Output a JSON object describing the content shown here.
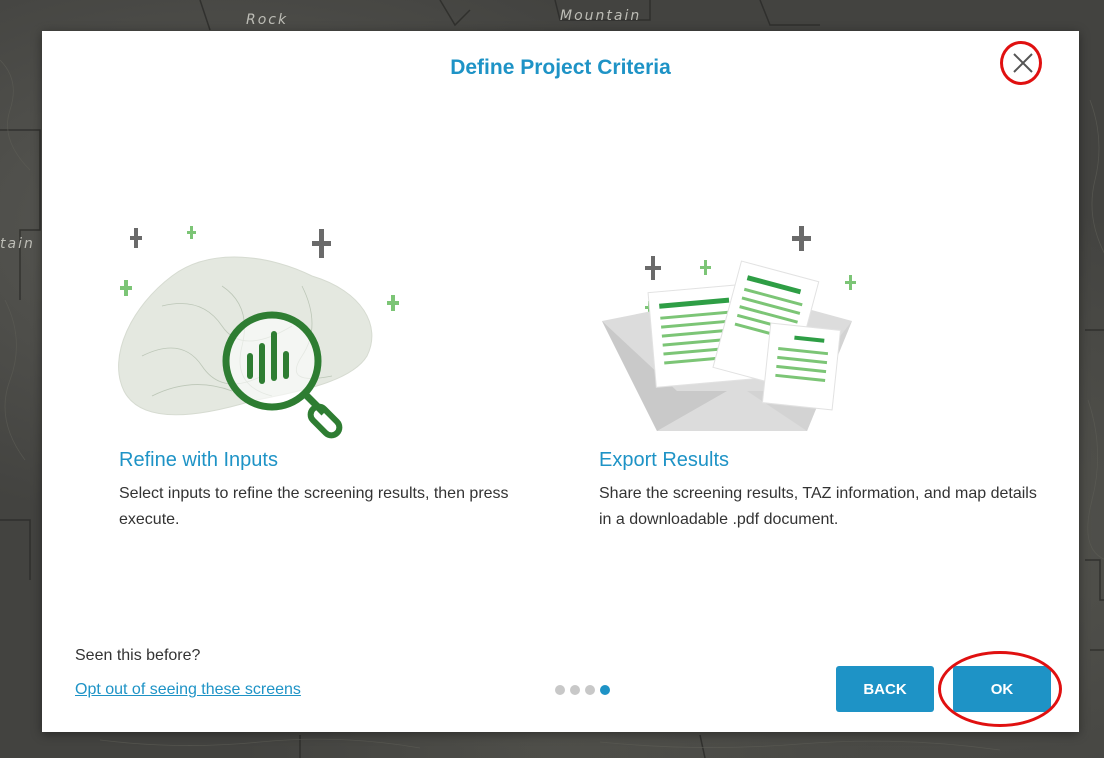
{
  "map": {
    "labels": [
      "Rock",
      "Mountain",
      "tain"
    ]
  },
  "modal": {
    "title": "Define Project Criteria",
    "close_icon": "close-icon",
    "cards": [
      {
        "title": "Refine with Inputs",
        "description": "Select inputs to refine the screening results, then press execute.",
        "illustration": "magnifier-map-icon"
      },
      {
        "title": "Export Results",
        "description": "Share the screening results, TAZ information, and map details in a downloadable .pdf document.",
        "illustration": "documents-export-icon"
      }
    ],
    "footer": {
      "seen_text": "Seen this before?",
      "optout_link": "Opt out of seeing these screens",
      "pagination": {
        "total": 4,
        "active_index": 3
      },
      "back_label": "BACK",
      "ok_label": "OK"
    }
  },
  "colors": {
    "accent": "#1e93c6",
    "green_dark": "#2e7d32",
    "green_light": "#7cc576",
    "annotation_red": "#e01010"
  }
}
